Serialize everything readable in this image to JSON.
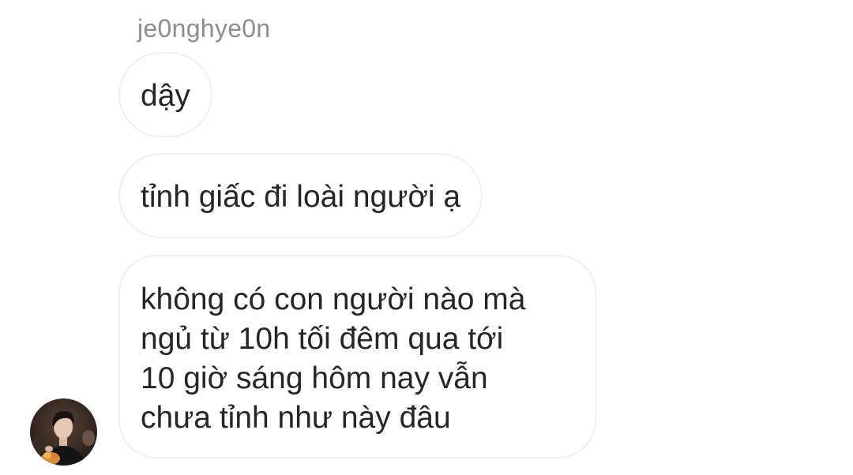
{
  "thread": {
    "sender_username": "je0nghye0n",
    "messages": [
      {
        "text": "dậy"
      },
      {
        "text": "tỉnh giấc đi loài người ạ"
      },
      {
        "lines": [
          "không có con người nào mà",
          "ngủ từ 10h tối đêm qua tới",
          "10 giờ sáng hôm nay vẫn",
          "chưa tỉnh như này đâu"
        ]
      }
    ],
    "avatar": {
      "icon": "profile-photo-avatar"
    }
  },
  "colors": {
    "background": "#ffffff",
    "bubble_border": "#efefef",
    "username_text": "#8e8e8e",
    "message_text": "#262626"
  }
}
